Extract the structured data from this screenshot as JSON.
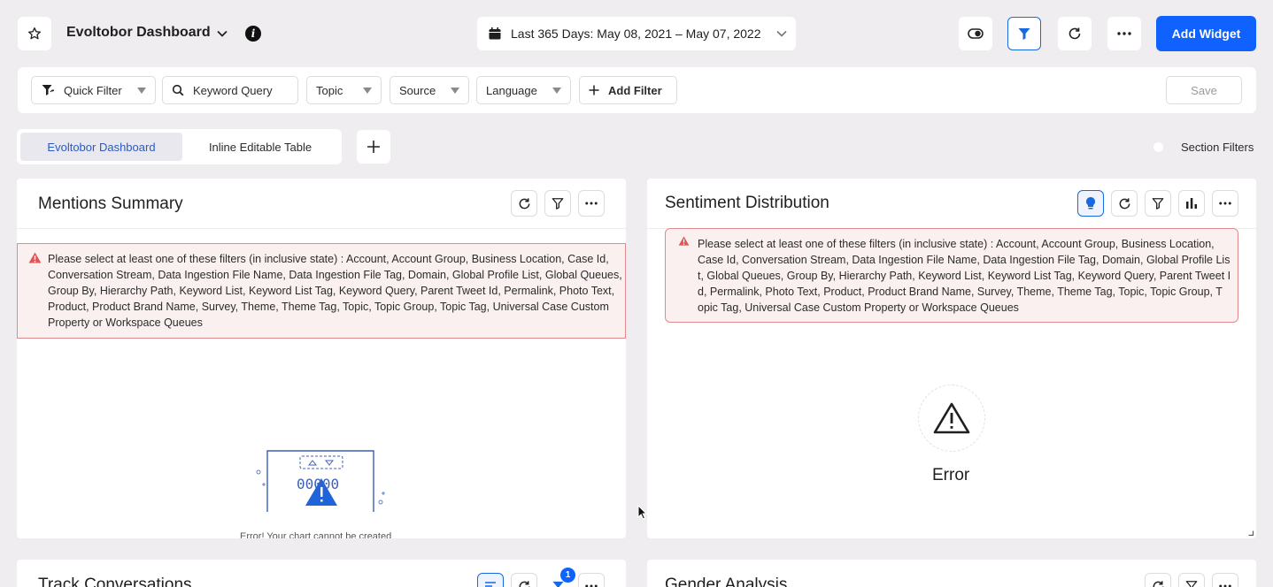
{
  "header": {
    "dashboard_title": "Evoltobor Dashboard",
    "date_range": "Last 365 Days: May 08, 2021 – May 07, 2022",
    "add_widget_label": "Add Widget"
  },
  "filter_bar": {
    "quick_filter": "Quick Filter",
    "keyword_query": "Keyword Query",
    "topic": "Topic",
    "source": "Source",
    "language": "Language",
    "add_filter": "Add Filter",
    "save": "Save"
  },
  "tabs": {
    "items": [
      {
        "label": "Evoltobor Dashboard",
        "active": true
      },
      {
        "label": "Inline Editable Table",
        "active": false
      }
    ],
    "section_filters_label": "Section Filters"
  },
  "widgets": {
    "mentions": {
      "title": "Mentions Summary",
      "alert_lines": [
        "Please select at least one of these filters (in inclusive state) : Account, Account Group, Business Location, Case Id,",
        "Conversation Stream, Data Ingestion File Name, Data Ingestion File Tag, Domain, Global Profile List, Global Queues,",
        "Group By, Hierarchy Path, Keyword List, Keyword List Tag, Keyword Query, Parent Tweet Id, Permalink, Photo Text,",
        "Product, Product Brand Name, Survey, Theme, Theme Tag, Topic, Topic Group, Topic Tag, Universal Case Custom",
        "Property or Workspace Queues"
      ],
      "illustration_digits": "00000",
      "error_caption": "Error! Your chart cannot be created"
    },
    "sentiment": {
      "title": "Sentiment Distribution",
      "alert_lines": [
        "Please select at least one of these filters (in inclusive state) : Account, Account Group, Business Location,",
        "Case Id, Conversation Stream, Data Ingestion File Name, Data Ingestion File Tag, Domain, Global Profile Lis",
        "t, Global Queues, Group By, Hierarchy Path, Keyword List, Keyword List Tag, Keyword Query, Parent Tweet I",
        "d, Permalink, Photo Text, Product, Product Brand Name, Survey, Theme, Theme Tag, Topic, Topic Group, T",
        "opic Tag, Universal Case Custom Property or Workspace Queues"
      ],
      "error_label": "Error"
    },
    "track": {
      "title": "Track Conversations",
      "filter_badge": "1"
    },
    "gender": {
      "title": "Gender Analysis"
    }
  },
  "colors": {
    "accent": "#0f62fe",
    "alert_bg": "#fbf0f0",
    "alert_border": "#e08b8b",
    "page_bg": "#efedef"
  }
}
